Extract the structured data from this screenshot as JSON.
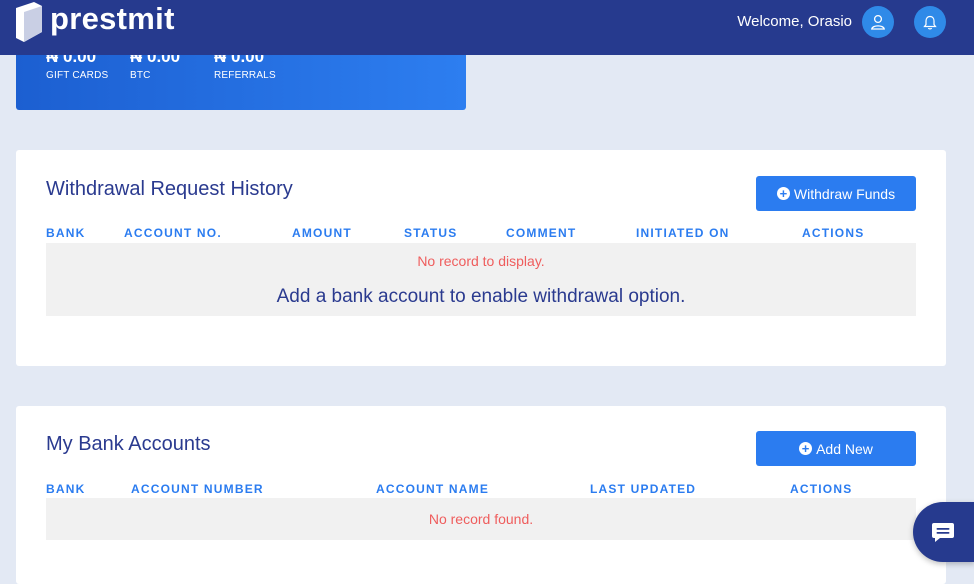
{
  "header": {
    "brand": "prestmit",
    "welcome": "Welcome, Orasio",
    "user_icon": "user-icon",
    "bell_icon": "bell-icon"
  },
  "balances": [
    {
      "amount": "₦ 0.00",
      "label": "GIFT CARDS"
    },
    {
      "amount": "₦ 0.00",
      "label": "BTC"
    },
    {
      "amount": "₦ 0.00",
      "label": "REFERRALS"
    }
  ],
  "withdrawals": {
    "title": "Withdrawal Request History",
    "button_label": "Withdraw Funds",
    "columns": [
      "BANK",
      "ACCOUNT NO.",
      "AMOUNT",
      "STATUS",
      "COMMENT",
      "INITIATED ON",
      "ACTIONS"
    ],
    "empty_text": "No record to display.",
    "hint": "Add a bank account to enable withdrawal option."
  },
  "bank_accounts": {
    "title": "My Bank Accounts",
    "button_label": "Add New",
    "columns": [
      "BANK",
      "ACCOUNT NUMBER",
      "ACCOUNT NAME",
      "LAST UPDATED",
      "ACTIONS"
    ],
    "empty_text": "No record found."
  },
  "colors": {
    "header": "#263a8e",
    "accent": "#2b7cf0",
    "empty_text": "#ef5d5d",
    "background": "#e3e9f4"
  },
  "chat_icon": "chat-icon"
}
